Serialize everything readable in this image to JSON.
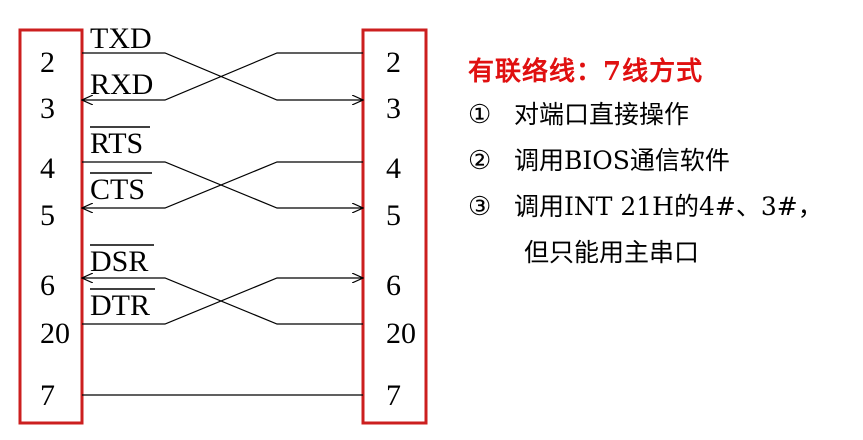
{
  "left_connector": {
    "pins": [
      "2",
      "3",
      "4",
      "5",
      "6",
      "20",
      "7"
    ]
  },
  "right_connector": {
    "pins": [
      "2",
      "3",
      "4",
      "5",
      "6",
      "20",
      "7"
    ]
  },
  "signals": [
    "TXD",
    "RXD",
    "RTS",
    "CTS",
    "DSR",
    "DTR"
  ],
  "notes": {
    "title": "有联络线：7线方式",
    "items": [
      {
        "num": "①",
        "text": "对端口直接操作"
      },
      {
        "num": "②",
        "text": "调用BIOS通信软件"
      },
      {
        "num": "③",
        "text": "调用INT 21H的4#、3#，"
      }
    ],
    "continuation": "但只能用主串口"
  },
  "colors": {
    "connector_border": "#cc1f1f",
    "title": "#e01010",
    "line": "#000000"
  }
}
